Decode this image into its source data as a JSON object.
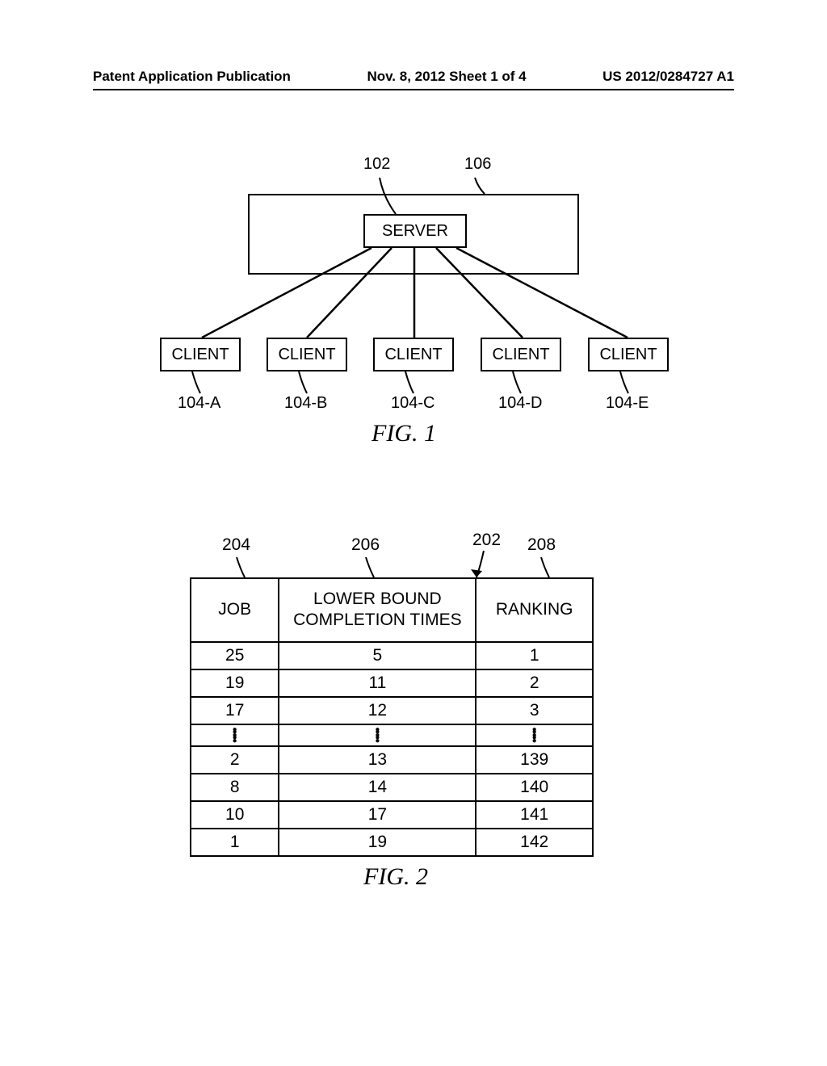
{
  "header": {
    "left": "Patent Application Publication",
    "center": "Nov. 8, 2012  Sheet 1 of 4",
    "right": "US 2012/0284727 A1"
  },
  "fig1": {
    "caption": "FIG. 1",
    "ref_server": "102",
    "ref_outer": "106",
    "server_label": "SERVER",
    "client_label": "CLIENT",
    "clients": [
      {
        "ref": "104-A"
      },
      {
        "ref": "104-B"
      },
      {
        "ref": "104-C"
      },
      {
        "ref": "104-D"
      },
      {
        "ref": "104-E"
      }
    ]
  },
  "fig2": {
    "caption": "FIG. 2",
    "ref_table": "202",
    "ref_col_job": "204",
    "ref_col_lower": "206",
    "ref_col_rank": "208",
    "headers": {
      "job": "JOB",
      "lower": "LOWER BOUND COMPLETION TIMES",
      "rank": "RANKING"
    },
    "rows": [
      {
        "job": "25",
        "lower": "5",
        "rank": "1"
      },
      {
        "job": "19",
        "lower": "11",
        "rank": "2"
      },
      {
        "job": "17",
        "lower": "12",
        "rank": "3"
      },
      {
        "job": "2",
        "lower": "13",
        "rank": "139"
      },
      {
        "job": "8",
        "lower": "14",
        "rank": "140"
      },
      {
        "job": "10",
        "lower": "17",
        "rank": "141"
      },
      {
        "job": "1",
        "lower": "19",
        "rank": "142"
      }
    ]
  }
}
